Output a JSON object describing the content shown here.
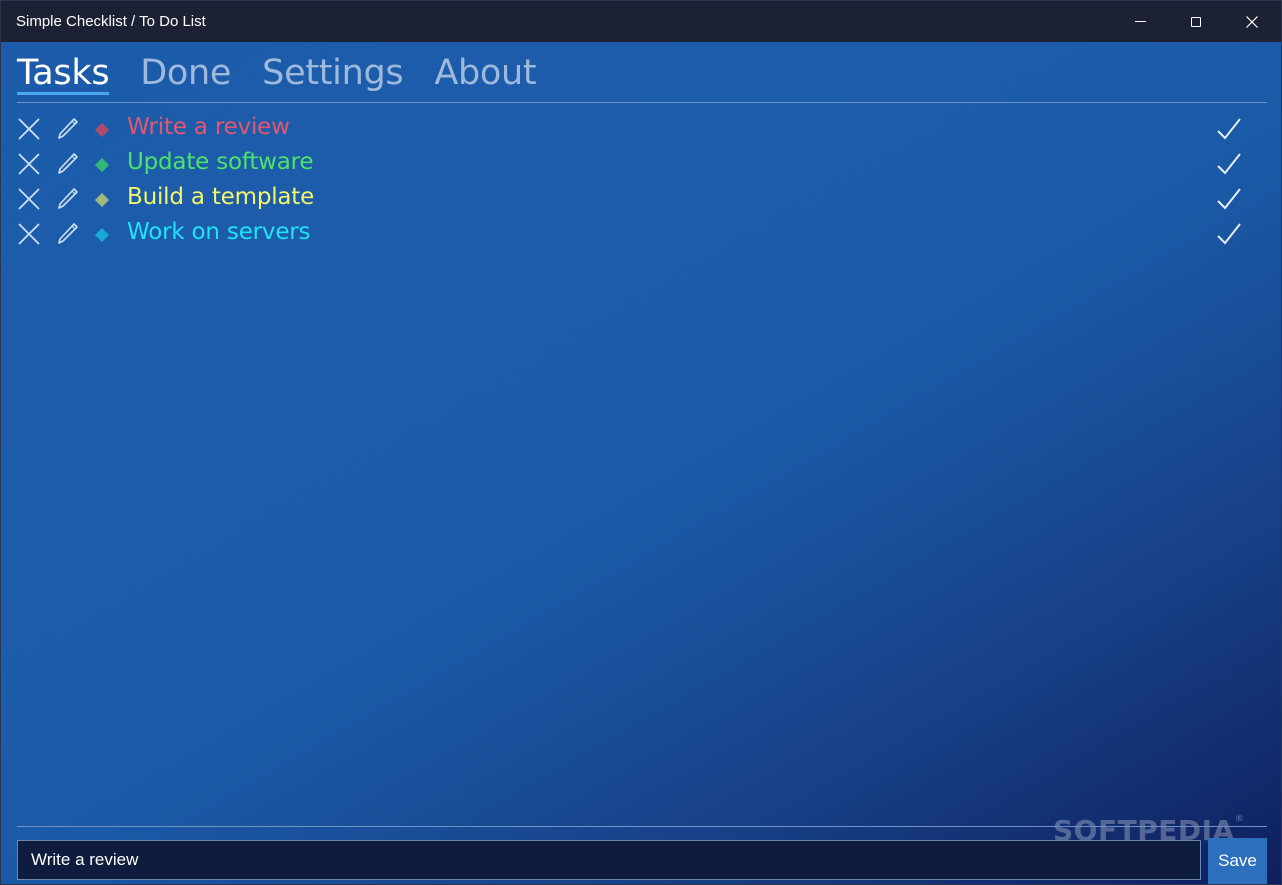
{
  "window": {
    "title": "Simple Checklist / To Do List"
  },
  "tabs": [
    {
      "label": "Tasks",
      "active": true
    },
    {
      "label": "Done",
      "active": false
    },
    {
      "label": "Settings",
      "active": false
    },
    {
      "label": "About",
      "active": false
    }
  ],
  "tasks": [
    {
      "label": "Write a review",
      "text_color": "#e8556d",
      "diamond_color": "#b04a6a"
    },
    {
      "label": "Update software",
      "text_color": "#4de36a",
      "diamond_color": "#34b87a"
    },
    {
      "label": "Build a template",
      "text_color": "#f3f56a",
      "diamond_color": "#9cb87a"
    },
    {
      "label": "Work on servers",
      "text_color": "#1ee4f5",
      "diamond_color": "#17a8d4"
    }
  ],
  "input": {
    "value": "Write a review",
    "placeholder": ""
  },
  "save_label": "Save",
  "watermark": "SOFTPEDIA",
  "icons": {
    "delete": "close-icon",
    "edit": "pencil-icon",
    "complete": "checkmark-icon",
    "color_marker": "diamond-icon"
  }
}
